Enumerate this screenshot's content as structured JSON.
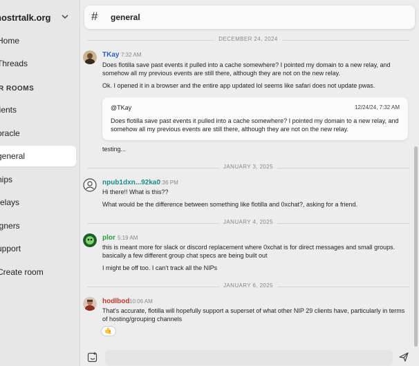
{
  "sidebar": {
    "title": "nostrtalk.org",
    "items": [
      {
        "label": "Home"
      },
      {
        "label": "Threads"
      }
    ],
    "section_label": "R ROOMS",
    "rooms": [
      {
        "label": "lients"
      },
      {
        "label": "oracle"
      },
      {
        "label": "general"
      },
      {
        "label": "nips"
      },
      {
        "label": "relays"
      },
      {
        "label": "igners"
      },
      {
        "label": "upport"
      },
      {
        "label": "Create room"
      }
    ]
  },
  "channel": {
    "hash": "#",
    "name": "general"
  },
  "dates": {
    "d1": "DECEMBER 24, 2024",
    "d2": "JANUARY 3, 2025",
    "d3": "JANUARY 4, 2025",
    "d4": "JANUARY 6, 2025"
  },
  "messages": {
    "m1": {
      "author": "TKay",
      "author_color": "#2b5fc4",
      "time": "7:32 AM",
      "lines": [
        "Does flotilla save past events it pulled into a cache somewhere? I pointed my domain to a new relay, and somehow all my previous events are still there, although they are not on the new relay.",
        "Ok. I opened it in a browser and the entire app updated lol seems like safari does not update pwas."
      ],
      "quote": {
        "author": "@TKay",
        "time": "12/24/24, 7:32 AM",
        "text": "Does flotilla save past events it pulled into a cache somewhere? I pointed my domain to a new relay, and somehow all my previous events are still there, although they are not on the new relay."
      },
      "after_quote": "testing..."
    },
    "m2": {
      "author": "npub1dxn...92ka0",
      "author_color": "#1f8a8a",
      "time": "7:36 PM",
      "lines": [
        "Hi there!! What is this??",
        "What would be the difference between something like flotilla and 0xchat?, asking for a friend."
      ]
    },
    "m3": {
      "author": "plor",
      "author_color": "#2f9a3c",
      "time": "5:19 AM",
      "lines": [
        "this is meant more for slack or discord replacement where 0xchat is for direct messages and small groups. basically a few different group chat specs are being built out",
        "I might be off too. I can't track all the NIPs"
      ]
    },
    "m4": {
      "author": "hodlbod",
      "author_color": "#c23a2b",
      "time": "10:06 AM",
      "lines": [
        "That's accurate, flotilla will hopefully support a superset of what other NIP 29 clients have, particularly in terms of hosting/grouping channels"
      ],
      "reaction": "🤙"
    }
  },
  "composer": {
    "placeholder": ""
  },
  "icons": {
    "chevron": "chevron-down-icon",
    "compose": "compose-icon",
    "send": "send-icon"
  }
}
